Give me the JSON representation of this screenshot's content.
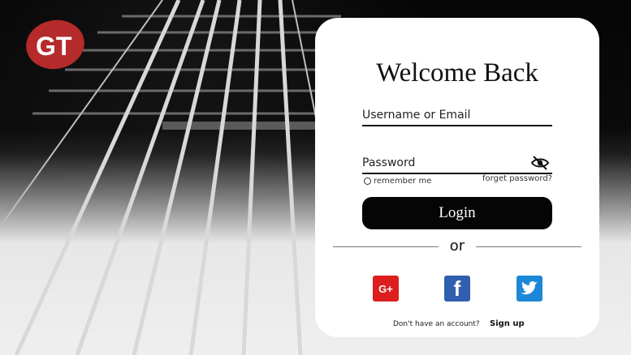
{
  "logo": {
    "text": "GT",
    "color": "#b52a2a"
  },
  "login": {
    "title": "Welcome Back",
    "username_placeholder": "Username or Email",
    "password_placeholder": "Password",
    "remember_label": "remember me",
    "forget_label": "forget password?",
    "login_label": "Login",
    "or_label": "or",
    "social": {
      "google_label": "G+",
      "facebook_label": "f"
    },
    "no_account_text": "Don't have an account?",
    "signup_label": "Sign up"
  },
  "icons": {
    "eye": "eye-slash-icon",
    "google": "google-plus-icon",
    "facebook": "facebook-icon",
    "twitter": "twitter-icon"
  },
  "colors": {
    "accent_dark": "#050505",
    "google": "#dd1e1e",
    "facebook": "#2f5fae",
    "twitter": "#1e88d8"
  }
}
